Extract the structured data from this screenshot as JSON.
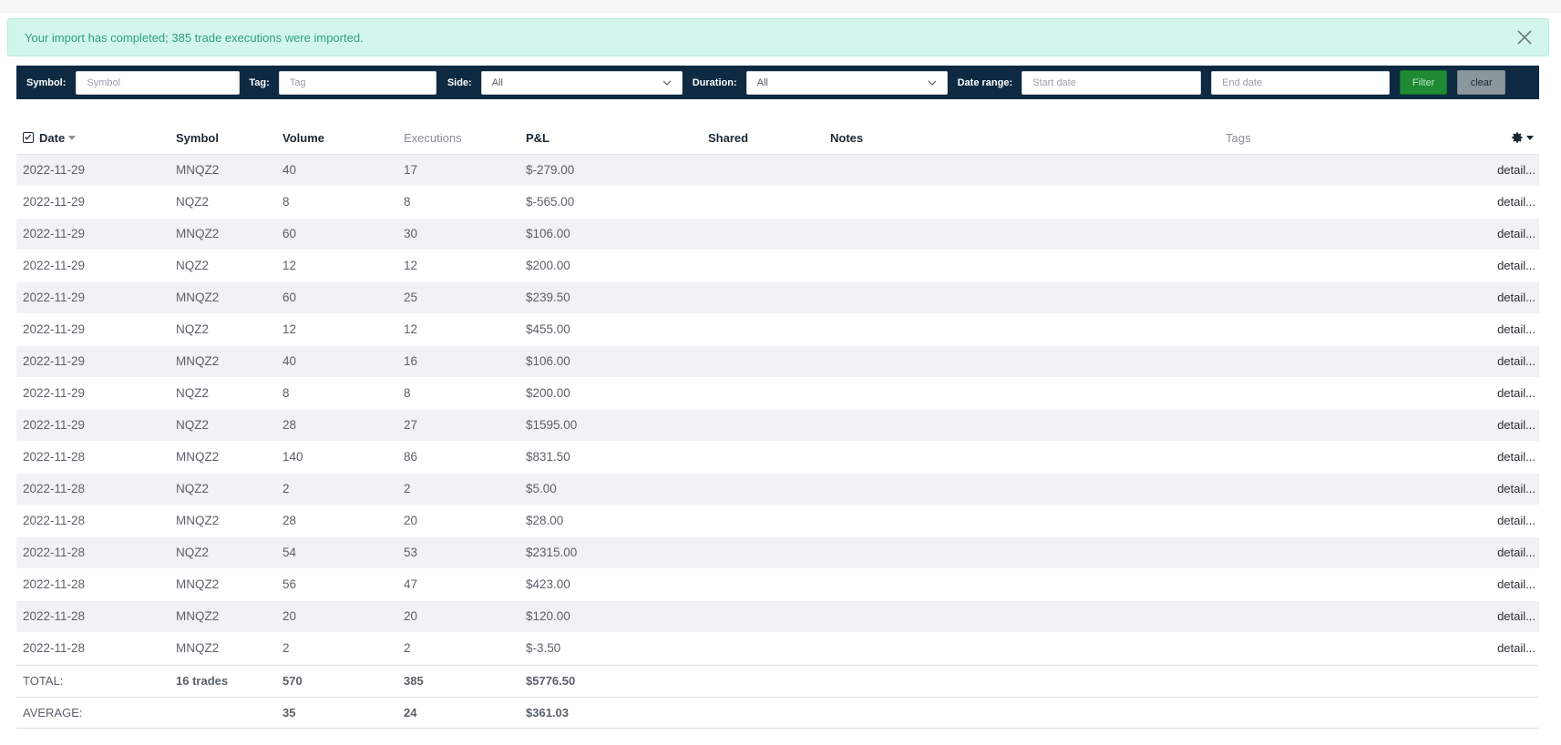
{
  "alert": {
    "message": "Your import has completed; 385 trade executions were imported.",
    "close_icon": "close-icon"
  },
  "filters": {
    "symbol_label": "Symbol:",
    "symbol_placeholder": "Symbol",
    "tag_label": "Tag:",
    "tag_placeholder": "Tag",
    "side_label": "Side:",
    "side_value": "All",
    "duration_label": "Duration:",
    "duration_value": "All",
    "date_range_label": "Date range:",
    "start_placeholder": "Start date",
    "end_placeholder": "End date",
    "filter_button": "Filter",
    "clear_button": "clear"
  },
  "table": {
    "headers": {
      "date": "Date",
      "symbol": "Symbol",
      "volume": "Volume",
      "executions": "Executions",
      "pnl": "P&L",
      "shared": "Shared",
      "notes": "Notes",
      "tags": "Tags"
    },
    "detail_label": "detail...",
    "rows": [
      {
        "date": "2022-11-29",
        "symbol": "MNQZ2",
        "volume": "40",
        "executions": "17",
        "pnl": "$-279.00"
      },
      {
        "date": "2022-11-29",
        "symbol": "NQZ2",
        "volume": "8",
        "executions": "8",
        "pnl": "$-565.00"
      },
      {
        "date": "2022-11-29",
        "symbol": "MNQZ2",
        "volume": "60",
        "executions": "30",
        "pnl": "$106.00"
      },
      {
        "date": "2022-11-29",
        "symbol": "NQZ2",
        "volume": "12",
        "executions": "12",
        "pnl": "$200.00"
      },
      {
        "date": "2022-11-29",
        "symbol": "MNQZ2",
        "volume": "60",
        "executions": "25",
        "pnl": "$239.50"
      },
      {
        "date": "2022-11-29",
        "symbol": "NQZ2",
        "volume": "12",
        "executions": "12",
        "pnl": "$455.00"
      },
      {
        "date": "2022-11-29",
        "symbol": "MNQZ2",
        "volume": "40",
        "executions": "16",
        "pnl": "$106.00"
      },
      {
        "date": "2022-11-29",
        "symbol": "NQZ2",
        "volume": "8",
        "executions": "8",
        "pnl": "$200.00"
      },
      {
        "date": "2022-11-29",
        "symbol": "NQZ2",
        "volume": "28",
        "executions": "27",
        "pnl": "$1595.00"
      },
      {
        "date": "2022-11-28",
        "symbol": "MNQZ2",
        "volume": "140",
        "executions": "86",
        "pnl": "$831.50"
      },
      {
        "date": "2022-11-28",
        "symbol": "NQZ2",
        "volume": "2",
        "executions": "2",
        "pnl": "$5.00"
      },
      {
        "date": "2022-11-28",
        "symbol": "MNQZ2",
        "volume": "28",
        "executions": "20",
        "pnl": "$28.00"
      },
      {
        "date": "2022-11-28",
        "symbol": "NQZ2",
        "volume": "54",
        "executions": "53",
        "pnl": "$2315.00"
      },
      {
        "date": "2022-11-28",
        "symbol": "MNQZ2",
        "volume": "56",
        "executions": "47",
        "pnl": "$423.00"
      },
      {
        "date": "2022-11-28",
        "symbol": "MNQZ2",
        "volume": "20",
        "executions": "20",
        "pnl": "$120.00"
      },
      {
        "date": "2022-11-28",
        "symbol": "MNQZ2",
        "volume": "2",
        "executions": "2",
        "pnl": "$-3.50"
      }
    ],
    "total": {
      "label": "TOTAL:",
      "trades": "16 trades",
      "volume": "570",
      "executions": "385",
      "pnl": "$5776.50"
    },
    "average": {
      "label": "AVERAGE:",
      "volume": "35",
      "executions": "24",
      "pnl": "$361.03"
    }
  },
  "colors": {
    "filterbar": "#0e2a42",
    "alert_bg": "#d3f6ec",
    "filter_button": "#1e8a33",
    "stripe": "#f1f2f6"
  }
}
